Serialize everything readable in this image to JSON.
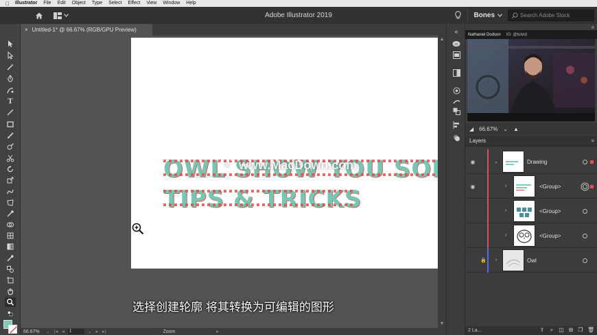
{
  "menubar": {
    "app_name": "Illustrator",
    "items": [
      "File",
      "Edit",
      "Object",
      "Type",
      "Select",
      "Effect",
      "View",
      "Window",
      "Help"
    ]
  },
  "appbar": {
    "title": "Adobe Illustrator 2019",
    "workspace": "Bones",
    "search_placeholder": "Search Adobe Stock"
  },
  "document": {
    "tab_label": "Untitled-1* @ 66.67% (RGB/GPU Preview)",
    "close_glyph": "×"
  },
  "artwork": {
    "line1": "OWL SHOW YOU SOM",
    "line2": "TIPS & TRICKS",
    "fill_color": "#76c6b3",
    "dot_color": "#e24f4f"
  },
  "watermark": "www.MacDown.com",
  "subtitle": "选择创建轮廓 将其转换为可编辑的图形",
  "status": {
    "zoom": "66.67%",
    "page": "1",
    "mode": "Zoom"
  },
  "webcam": {
    "name": "Nathaniel Dodson",
    "ig": "IG: @tutvid"
  },
  "navigator": {
    "zoom": "66.67%"
  },
  "layers_panel": {
    "title": "Layers",
    "rows": [
      {
        "name": "Drawing",
        "color": "#e24f4f"
      },
      {
        "name": "<Group>",
        "color": "#e24f4f"
      },
      {
        "name": "<Group>",
        "color": "#e24f4f"
      },
      {
        "name": "<Group>",
        "color": "#e24f4f"
      },
      {
        "name": "Owl",
        "color": "#4f6fe2"
      }
    ],
    "footer": "2 La..."
  },
  "icons": {
    "home": "home-icon",
    "lightbulb": "lightbulb-icon",
    "search": "search-icon",
    "zoom_tool": "zoom-in-icon"
  }
}
